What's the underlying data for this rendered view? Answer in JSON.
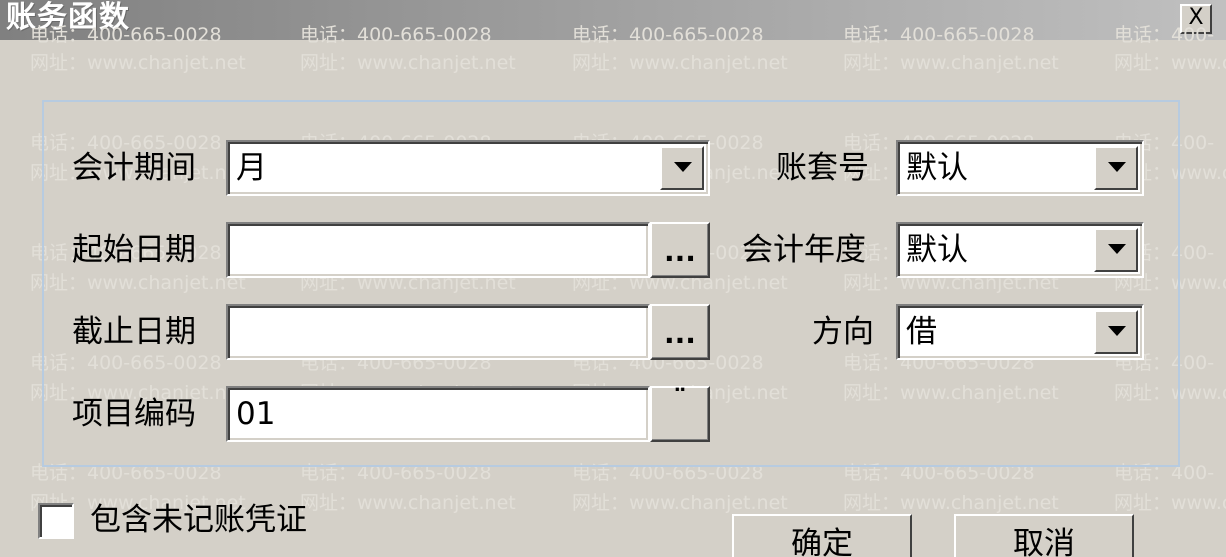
{
  "window": {
    "title": "账务函数",
    "close_glyph": "X"
  },
  "watermark": {
    "phone": "电话：400-665-0028",
    "phone_cut": "电话：400-",
    "site": "网址：www.chanjet.net",
    "site_cut": "网址：www.c"
  },
  "form": {
    "period_label": "会计期间",
    "period_value": "月",
    "start_label": "起始日期",
    "start_value": "",
    "end_label": "截止日期",
    "end_value": "",
    "item_label": "项目编码",
    "item_value": "01",
    "account_set_label": "账套号",
    "account_set_value": "默认",
    "year_label": "会计年度",
    "year_value": "默认",
    "direction_label": "方向",
    "direction_value": "借",
    "ellipsis": "...",
    "ellipsis_item": "¨"
  },
  "footer": {
    "include_unposted_label": "包含未记账凭证",
    "ok_label": "确定",
    "cancel_label": "取消"
  }
}
